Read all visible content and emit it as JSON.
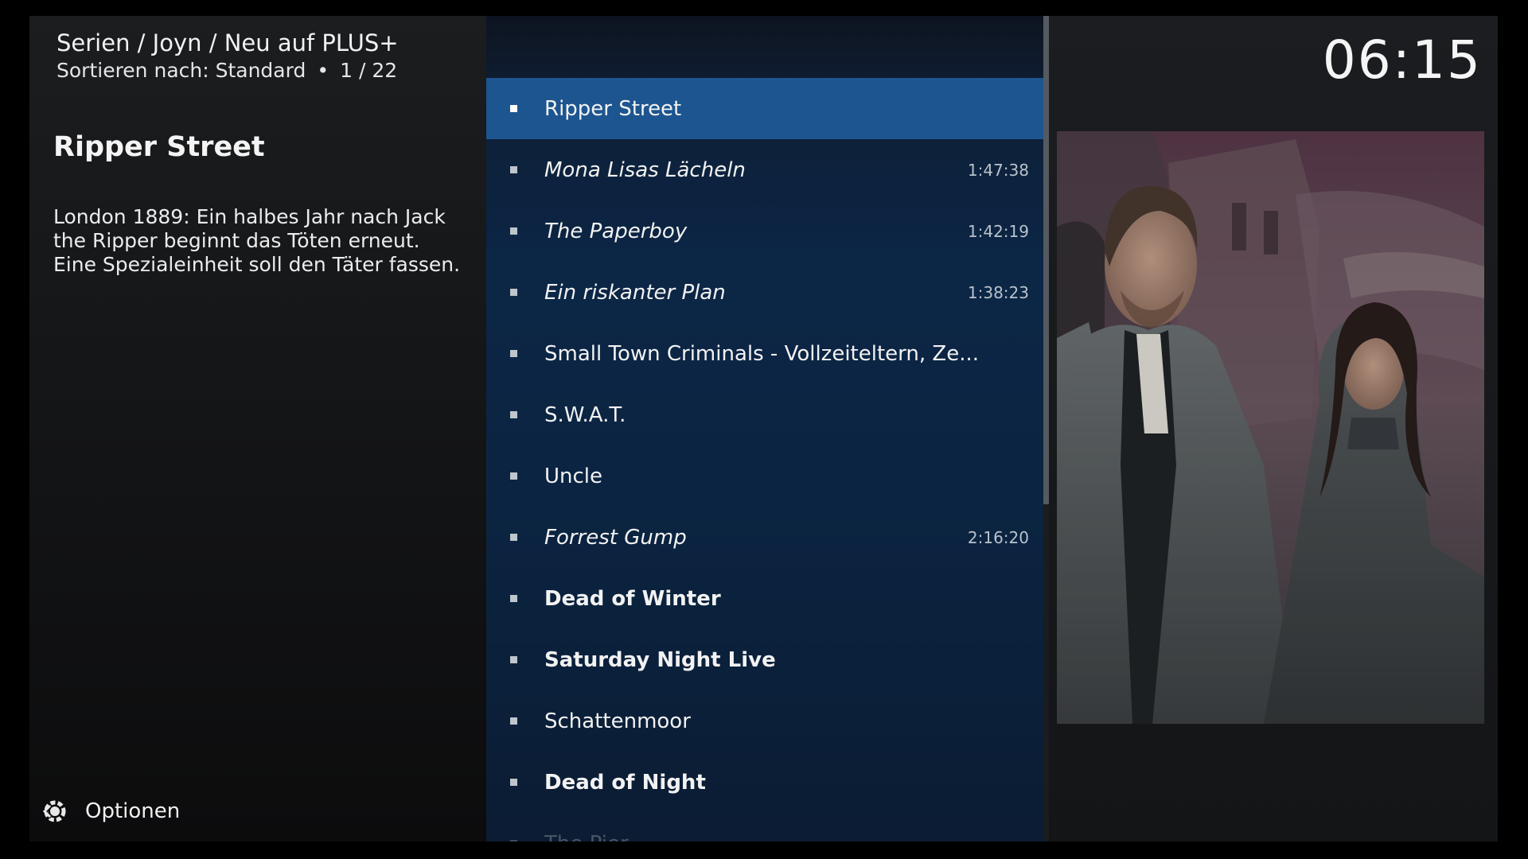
{
  "header": {
    "breadcrumb": "Serien / Joyn / Neu auf PLUS+",
    "sort_label": "Sortieren nach: Standard",
    "position": "1 / 22",
    "clock": "06:15"
  },
  "info": {
    "title": "Ripper Street",
    "plot": "London 1889: Ein halbes Jahr nach Jack the Ripper beginnt das Töten erneut. Eine Spezialeinheit soll den Täter fassen."
  },
  "footer": {
    "options_label": "Optionen",
    "options_icon": "options-gear-icon"
  },
  "list": {
    "items": [
      {
        "label": "Ripper Street",
        "duration": "",
        "style": "normal",
        "selected": true
      },
      {
        "label": "Mona Lisas Lächeln",
        "duration": "1:47:38",
        "style": "italic",
        "selected": false
      },
      {
        "label": "The Paperboy",
        "duration": "1:42:19",
        "style": "italic",
        "selected": false
      },
      {
        "label": "Ein riskanter Plan",
        "duration": "1:38:23",
        "style": "italic",
        "selected": false
      },
      {
        "label": "Small Town Criminals - Vollzeiteltern, Ze...",
        "duration": "",
        "style": "normal",
        "selected": false
      },
      {
        "label": "S.W.A.T.",
        "duration": "",
        "style": "normal",
        "selected": false
      },
      {
        "label": "Uncle",
        "duration": "",
        "style": "normal",
        "selected": false
      },
      {
        "label": "Forrest Gump",
        "duration": "2:16:20",
        "style": "italic",
        "selected": false
      },
      {
        "label": "Dead of Winter",
        "duration": "",
        "style": "bold",
        "selected": false
      },
      {
        "label": "Saturday Night Live",
        "duration": "",
        "style": "bold",
        "selected": false
      },
      {
        "label": "Schattenmoor",
        "duration": "",
        "style": "normal",
        "selected": false
      },
      {
        "label": "Dead of Night",
        "duration": "",
        "style": "bold",
        "selected": false
      },
      {
        "label": "The Pier",
        "duration": "",
        "style": "normal",
        "selected": false
      }
    ]
  },
  "colors": {
    "selected_row": "#1d5590",
    "list_background": "#0c2646"
  }
}
